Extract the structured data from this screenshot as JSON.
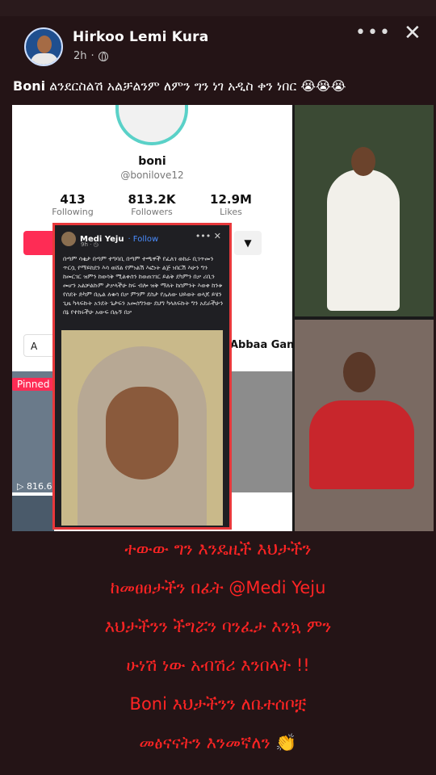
{
  "post": {
    "author": "Hirkoo Lemi Kura",
    "time": "2h",
    "caption_bold": "Boni",
    "caption_rest": " ልንደርስልሽ አልቻልንም ለምን ግን ነገ አዲስ ቀን ነበር 😭😭😭"
  },
  "header_icons": [
    "more-icon",
    "close-icon",
    "globe-icon"
  ],
  "tiktok_profile": {
    "handle": "boni",
    "username": "@bonilove12",
    "following": {
      "value": "413",
      "label": "Following"
    },
    "followers": {
      "value": "813.2K",
      "label": "Followers"
    },
    "likes": {
      "value": "12.9M",
      "label": "Likes"
    },
    "tab_left": "A",
    "tab_right": "Abbaa Gan",
    "pinned": "Pinned",
    "views": "▷ 816.6"
  },
  "embedded_post": {
    "author": "Medi Yeju",
    "follow": "· Follow",
    "time": "9h · ◷",
    "text": "በጣም ሳቂታ በጣም ተግባቢ በጣም ተጫዋች የፈለገ ወከራ ቢገጥመን ጥርሷ የማይከደን እሳ ወሸል የምነልሽ እፎነት ልጅ ነበርሽ እሁን ግን ከመርገር ዝምን ከወሳቅ ሚልቀሰን ከወጠገገር ይልቅ ደካምን በቃ ሪቢን መሆን አልቻልኩም ታቃላችሁ ከፍ ብሎ ዝቅ ማለት ከሰምንት እወቀ ከንቱ የሰደት ድካም በሌል ለቁሳ በቃ ምንም ደስታ የሌለው ህይወት ወላጆ ይሄን ጊዜ ካላፍኩት አንደት ጌታፍን አመሰግንው ደህግ ካላለፍኩት ግን አደራችሁን በኔ የተከሩችሁ አውፍ በሉኝ በቃ"
  },
  "overlay": {
    "lines": [
      "ተውው ግን እንዴዚች እህታችን",
      "ከመፀፀታችን በፊት @Medi Yeju",
      "እህታችንን ችግሯን ባንፈታ እንኳ ምን",
      "ሁነሽ ነው አብሽሪ እንበላት !!",
      "Boni እህታችንን ለቤተሰቦቿ",
      "መፅናናትን እንመኛለን 👏"
    ]
  },
  "colors": {
    "background": "#241416",
    "overlay_text": "#ff2424",
    "embed_border": "#e8383b",
    "tiktok_button": "#fe2c55"
  }
}
